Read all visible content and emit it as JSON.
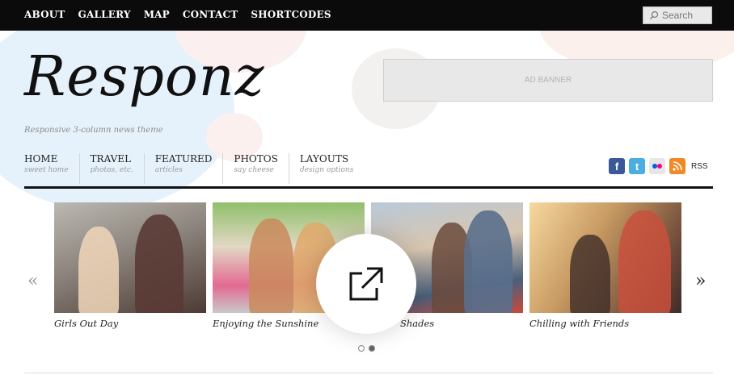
{
  "topnav": {
    "items": [
      "ABOUT",
      "GALLERY",
      "MAP",
      "CONTACT",
      "SHORTCODES"
    ],
    "search_label": "Search"
  },
  "header": {
    "logo": "Responz",
    "tagline": "Responsive 3-column news theme",
    "ad_label": "AD BANNER"
  },
  "mainnav": {
    "items": [
      {
        "title": "HOME",
        "sub": "sweet home"
      },
      {
        "title": "TRAVEL",
        "sub": "photos, etc."
      },
      {
        "title": "FEATURED",
        "sub": "articles"
      },
      {
        "title": "PHOTOS",
        "sub": "say cheese"
      },
      {
        "title": "LAYOUTS",
        "sub": "design options"
      }
    ]
  },
  "social": {
    "icons": [
      "facebook-icon",
      "twitter-icon",
      "flickr-icon",
      "rss-icon"
    ],
    "rss_label": "RSS"
  },
  "slider": {
    "prev": "«",
    "next": "»",
    "slides": [
      {
        "caption": "Girls Out Day"
      },
      {
        "caption": "Enjoying the Sunshine"
      },
      {
        "caption": "Shades"
      },
      {
        "caption": "Chilling with Friends"
      }
    ],
    "page_count": 2,
    "active_page": 2
  },
  "overlay": {
    "icon": "open-external-icon"
  },
  "colors": {
    "topbar": "#0b0b0b",
    "facebook": "#3b5998",
    "twitter": "#4aaee0",
    "rss": "#f08a24"
  }
}
